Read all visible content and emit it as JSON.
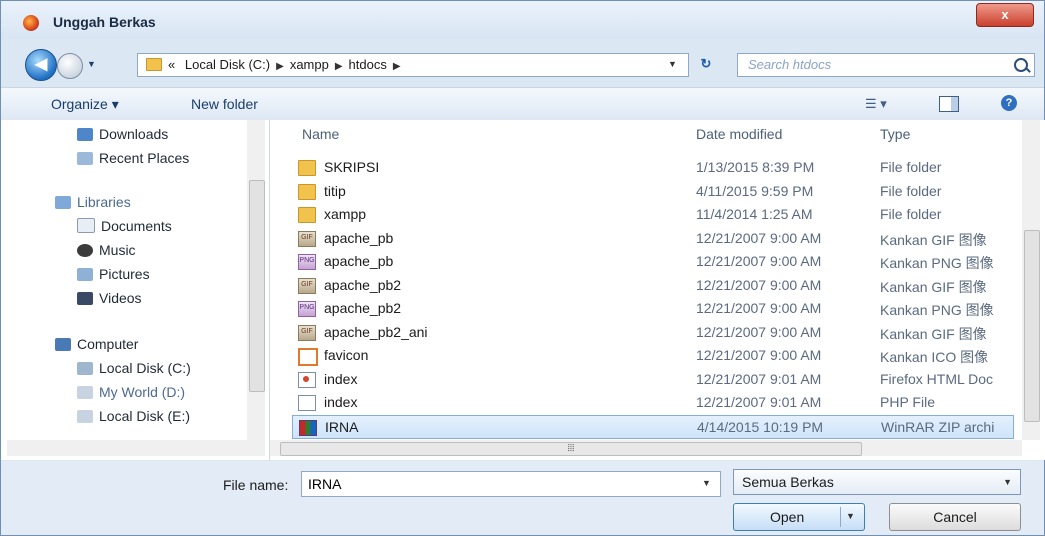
{
  "window": {
    "title": "Unggah Berkas",
    "close_label": "x"
  },
  "address": {
    "crumbs": [
      "«",
      "Local Disk (C:)",
      "xampp",
      "htdocs"
    ],
    "search_placeholder": "Search htdocs"
  },
  "toolbar": {
    "organize": "Organize ▾",
    "new_folder": "New folder"
  },
  "nav": {
    "favorites": [
      {
        "label": "Downloads",
        "icon": "downloads-icon"
      },
      {
        "label": "Recent Places",
        "icon": "recent-places-icon"
      }
    ],
    "libraries_label": "Libraries",
    "libraries": [
      {
        "label": "Documents",
        "icon": "documents-icon"
      },
      {
        "label": "Music",
        "icon": "music-icon"
      },
      {
        "label": "Pictures",
        "icon": "pictures-icon"
      },
      {
        "label": "Videos",
        "icon": "videos-icon"
      }
    ],
    "computer_label": "Computer",
    "drives": [
      {
        "label": "Local Disk (C:)",
        "icon": "drive-icon"
      },
      {
        "label": "My World (D:)",
        "icon": "drive-icon"
      },
      {
        "label": "Local Disk (E:)",
        "icon": "drive-icon"
      }
    ]
  },
  "columns": {
    "name": "Name",
    "date": "Date modified",
    "type": "Type"
  },
  "files": [
    {
      "name": "SKRIPSI",
      "date": "1/13/2015 8:39 PM",
      "type": "File folder",
      "icon": "folder"
    },
    {
      "name": "titip",
      "date": "4/11/2015 9:59 PM",
      "type": "File folder",
      "icon": "folder"
    },
    {
      "name": "xampp",
      "date": "11/4/2014 1:25 AM",
      "type": "File folder",
      "icon": "folder"
    },
    {
      "name": "apache_pb",
      "date": "12/21/2007 9:00 AM",
      "type": "Kankan GIF 图像",
      "icon": "gif"
    },
    {
      "name": "apache_pb",
      "date": "12/21/2007 9:00 AM",
      "type": "Kankan PNG 图像",
      "icon": "png"
    },
    {
      "name": "apache_pb2",
      "date": "12/21/2007 9:00 AM",
      "type": "Kankan GIF 图像",
      "icon": "gif"
    },
    {
      "name": "apache_pb2",
      "date": "12/21/2007 9:00 AM",
      "type": "Kankan PNG 图像",
      "icon": "png"
    },
    {
      "name": "apache_pb2_ani",
      "date": "12/21/2007 9:00 AM",
      "type": "Kankan GIF 图像",
      "icon": "gif"
    },
    {
      "name": "favicon",
      "date": "12/21/2007 9:00 AM",
      "type": "Kankan ICO 图像",
      "icon": "ico"
    },
    {
      "name": "index",
      "date": "12/21/2007 9:01 AM",
      "type": "Firefox HTML Doc",
      "icon": "html"
    },
    {
      "name": "index",
      "date": "12/21/2007 9:01 AM",
      "type": "PHP File",
      "icon": "php"
    },
    {
      "name": "IRNA",
      "date": "4/14/2015 10:19 PM",
      "type": "WinRAR ZIP archi",
      "icon": "zip",
      "selected": true
    }
  ],
  "bottom": {
    "file_name_label": "File name:",
    "file_name_value": "IRNA",
    "filter": "Semua Berkas",
    "open": "Open",
    "cancel": "Cancel"
  }
}
